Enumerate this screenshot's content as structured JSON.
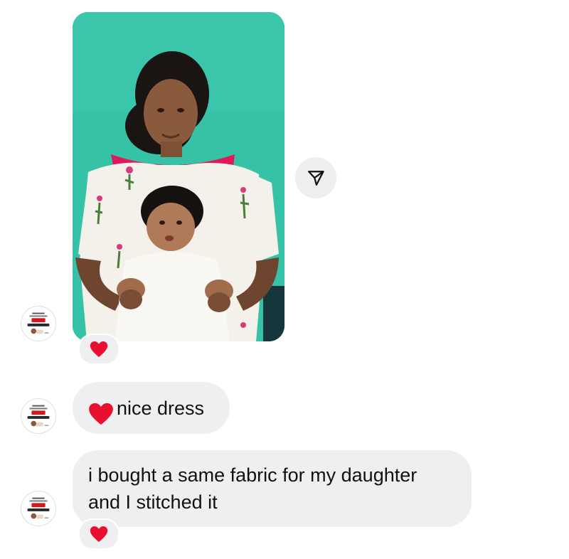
{
  "messages": [
    {
      "type": "photo",
      "sender": "incoming",
      "photo_description_icon": "photo-mother-and-baby",
      "reaction": "❤️"
    },
    {
      "type": "text",
      "sender": "incoming",
      "emoji": "❤️",
      "text": "nice dress"
    },
    {
      "type": "text",
      "sender": "incoming",
      "lines": [
        "i bought a same fabric for my daughter",
        "and I stitched it"
      ],
      "reaction": "❤️"
    }
  ],
  "actions": {
    "share_icon": "paper-plane-icon"
  },
  "colors": {
    "bubble": "#efeff1",
    "heart": "#e8102e",
    "photo_background": "#33c1a6"
  }
}
